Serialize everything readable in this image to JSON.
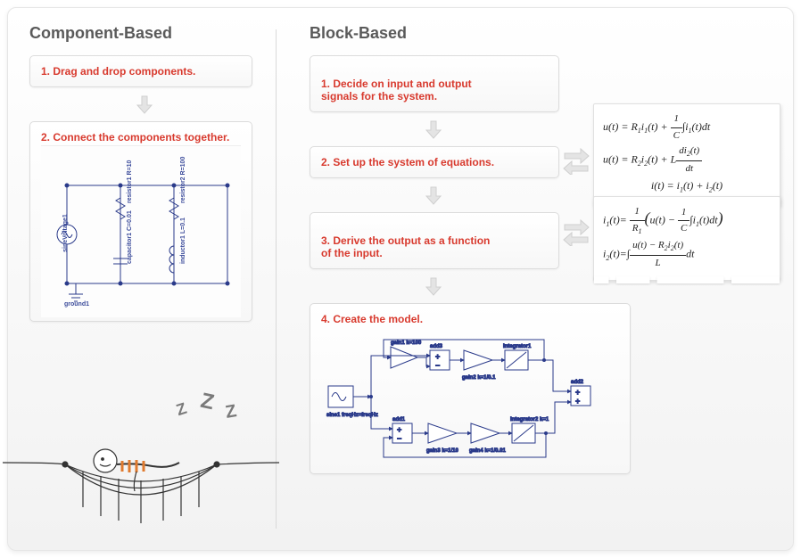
{
  "left": {
    "title": "Component-Based",
    "steps": [
      "1. Drag and drop components.",
      "2. Connect the components together."
    ],
    "circuit": {
      "labels": {
        "source": "sineVoltage1",
        "ground": "ground1",
        "r1": "resistor1  R=10",
        "c": "capacitor1  C=0.01",
        "r2": "resistor2  R=100",
        "l": "inductor1  L=0.1"
      }
    },
    "sleep": {
      "z1": "Z",
      "z2": "Z",
      "z3": "Z"
    }
  },
  "right": {
    "title": "Block-Based",
    "steps": [
      "1. Decide on input and output\n    signals for the system.",
      "2. Set up the system of equations.",
      "3. Derive the output as a function\n    of the input.",
      "4. Create the model."
    ],
    "equations_step2": [
      "u(t) = R₁i₁(t) + (1/C)∫i₁(t)dt",
      "u(t) = R₂i₂(t) + L·di₂(t)/dt",
      "i(t) = i₁(t) + i₂(t)"
    ],
    "equations_step3": [
      "i₁(t) = (1/R₁)(u(t) − (1/C)∫i₁(t)dt)",
      "i₂(t) = ∫(u(t) − R₂i₂(t))/L dt"
    ],
    "block_labels": {
      "src": "sine1  freqHz=freqHz",
      "gain1": "gain1  k=100",
      "add3": "add3",
      "gain2": "gain2  k=1/0.1",
      "int1": "integrator1",
      "add2": "add2",
      "add1": "add1",
      "gain3": "gain3  k=1/10",
      "gain4": "gain4  k=1/0.01",
      "int2": "integrator2  k=1"
    }
  }
}
